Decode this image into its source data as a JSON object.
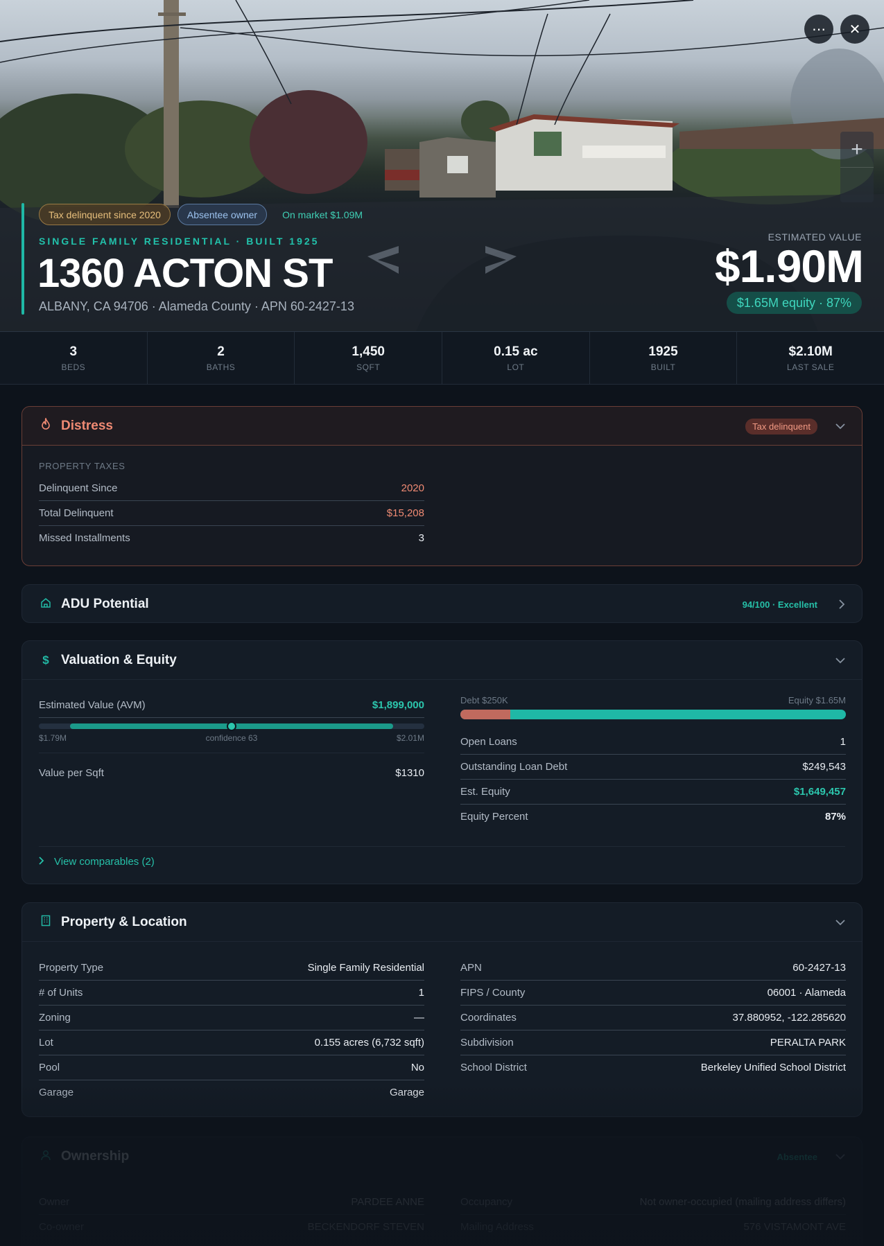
{
  "hero": {
    "more_icon": "more-horizontal-icon",
    "close_icon": "close-icon",
    "zoom_in": "+",
    "zoom_out": "",
    "tags": [
      "Tax delinquent since 2020",
      "Absentee owner",
      "On market $1.09M"
    ],
    "kicker": "SINGLE FAMILY RESIDENTIAL · BUILT 1925",
    "address": "1360 ACTON ST",
    "subaddress": "ALBANY, CA 94706 · Alameda County · APN 60-2427-13",
    "estimated_label": "ESTIMATED VALUE",
    "estimated_value": "$1.90M",
    "equity_pill": "$1.65M equity · 87%"
  },
  "stats": [
    {
      "value": "3",
      "label": "BEDS"
    },
    {
      "value": "2",
      "label": "BATHS"
    },
    {
      "value": "1,450",
      "label": "SQFT"
    },
    {
      "value": "0.15 ac",
      "label": "LOT"
    },
    {
      "value": "1925",
      "label": "BUILT"
    },
    {
      "value": "$2.10M",
      "label": "LAST SALE"
    }
  ],
  "distress": {
    "title": "Distress",
    "badge": "Tax delinquent",
    "section": "PROPERTY TAXES",
    "rows": [
      {
        "k": "Delinquent Since",
        "v": "2020"
      },
      {
        "k": "Total Delinquent",
        "v": "$15,208"
      },
      {
        "k": "Missed Installments",
        "v": "3"
      }
    ]
  },
  "adu": {
    "title": "ADU Potential",
    "score": "94/100 · Excellent"
  },
  "valuation": {
    "title": "Valuation & Equity",
    "avm_label": "Estimated Value (AVM)",
    "avm_value": "$1,899,000",
    "avm_low": "$1.79M",
    "avm_confidence": "confidence 63",
    "avm_high": "$2.01M",
    "avm_position": 0.5,
    "ppsf_label": "Value per Sqft",
    "ppsf_value": "$1310",
    "debt_label": "Debt $250K",
    "equity_label": "Equity $1.65M",
    "debt_fraction": 0.13,
    "rows": [
      {
        "k": "Open Loans",
        "v": "1"
      },
      {
        "k": "Outstanding Loan Debt",
        "v": "$249,543"
      },
      {
        "k": "Est. Equity",
        "v": "$1,649,457"
      },
      {
        "k": "Equity Percent",
        "v": "87%"
      }
    ],
    "comps": "View comparables (2)"
  },
  "property": {
    "title": "Property & Location",
    "left": [
      {
        "k": "Property Type",
        "v": "Single Family Residential"
      },
      {
        "k": "# of Units",
        "v": "1"
      },
      {
        "k": "Zoning",
        "v": "—"
      },
      {
        "k": "Lot",
        "v": "0.155 acres (6,732 sqft)"
      },
      {
        "k": "Pool",
        "v": "No"
      },
      {
        "k": "Garage",
        "v": "Garage"
      }
    ],
    "right": [
      {
        "k": "APN",
        "v": "60-2427-13"
      },
      {
        "k": "FIPS / County",
        "v": "06001 · Alameda"
      },
      {
        "k": "Coordinates",
        "v": "37.880952, -122.285620"
      },
      {
        "k": "Subdivision",
        "v": "PERALTA PARK"
      },
      {
        "k": "School District",
        "v": "Berkeley Unified School District"
      }
    ]
  },
  "ownership": {
    "title": "Ownership",
    "badge": "Absentee",
    "left": [
      {
        "k": "Owner",
        "v": "PARDEE ANNE"
      },
      {
        "k": "Co-owner",
        "v": "BECKENDORF STEVEN"
      }
    ],
    "right": [
      {
        "k": "Occupancy",
        "v": "Not owner-occupied (mailing address differs)"
      },
      {
        "k": "Mailing Address",
        "v": "576 VISTAMONT AVE"
      }
    ]
  },
  "colors": {
    "accent": "#1fb8a6",
    "danger": "#ef8a73",
    "background": "#0d131b"
  }
}
